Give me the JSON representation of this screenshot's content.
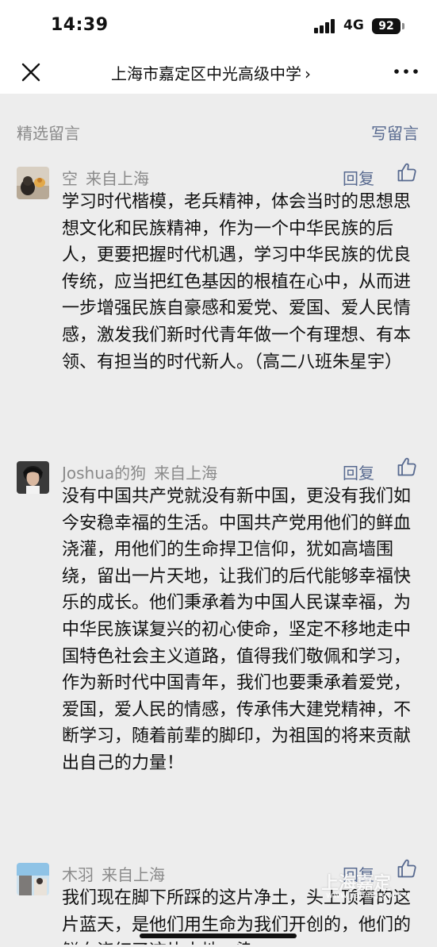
{
  "status_bar": {
    "time": "14:39",
    "network": "4G",
    "battery": "92"
  },
  "nav": {
    "title": "上海市嘉定区中光高级中学",
    "chevron": "›",
    "close_icon": "close-icon",
    "more_icon": "more-icon"
  },
  "section": {
    "title": "精选留言",
    "write_label": "写留言"
  },
  "comments": [
    {
      "author": "空",
      "location": "来自上海",
      "reply_label": "回复",
      "text": "学习时代楷模，老兵精神，体会当时的思想思想文化和民族精神，作为一个中华民族的后人，更要把握时代机遇，学习中华民族的优良传统，应当把红色基因的根植在心中，从而进一步增强民族自豪感和爱党、爱国、爱人民情感，激发我们新时代青年做一个有理想、有本领、有担当的时代新人。（高二八班朱星宇）"
    },
    {
      "author": "Joshua的狗",
      "location": "来自上海",
      "reply_label": "回复",
      "text": "没有中国共产党就没有新中国，更没有我们如今安稳幸福的生活。中国共产党用他们的鲜血浇灌，用他们的生命捍卫信仰，犹如高墙围绕，留出一片天地，让我们的后代能够幸福快乐的成长。他们秉承着为中国人民谋幸福，为中华民族谋复兴的初心使命，坚定不移地走中国特色社会主义道路，值得我们敬佩和学习，作为新时代中国青年，我们也要秉承着爱党，爱国，爱人民的情感，传承伟大建党精神，不断学习，随着前辈的脚印，为祖国的将来贡献出自己的力量！"
    },
    {
      "author": "木羽",
      "location": "来自上海",
      "reply_label": "回复",
      "text": "我们现在脚下所踩的这片净土，头上顶着的这片蓝天，是他们用生命为我们开创的，他们的鲜血浇红了这片土地，染"
    }
  ],
  "watermark": {
    "text": "上海嘉定",
    "url": "www.jiading.gov.cn"
  },
  "colors": {
    "link": "#57698f",
    "muted": "#8a8a8a",
    "background": "#ededed"
  }
}
